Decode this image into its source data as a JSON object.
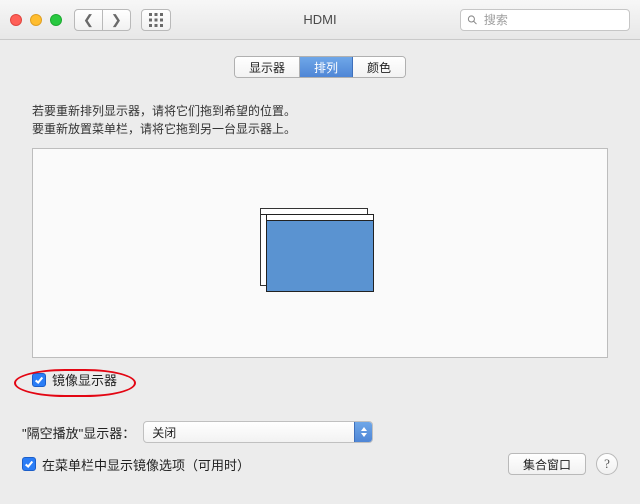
{
  "window": {
    "title": "HDMI"
  },
  "search": {
    "placeholder": "搜索"
  },
  "tabs": {
    "display": "显示器",
    "arrange": "排列",
    "color": "颜色",
    "active": "arrange"
  },
  "instructions": {
    "line1": "若要重新排列显示器，请将它们拖到希望的位置。",
    "line2": "要重新放置菜单栏，请将它拖到另一台显示器上。"
  },
  "mirror": {
    "label": "镜像显示器",
    "checked": true
  },
  "airplay": {
    "label_prefix": "\"隔空播放\"显示器：",
    "selected": "关闭"
  },
  "menubar_option": {
    "label": "在菜单栏中显示镜像选项（可用时）",
    "checked": true
  },
  "gather_button": "集合窗口",
  "help_glyph": "?"
}
